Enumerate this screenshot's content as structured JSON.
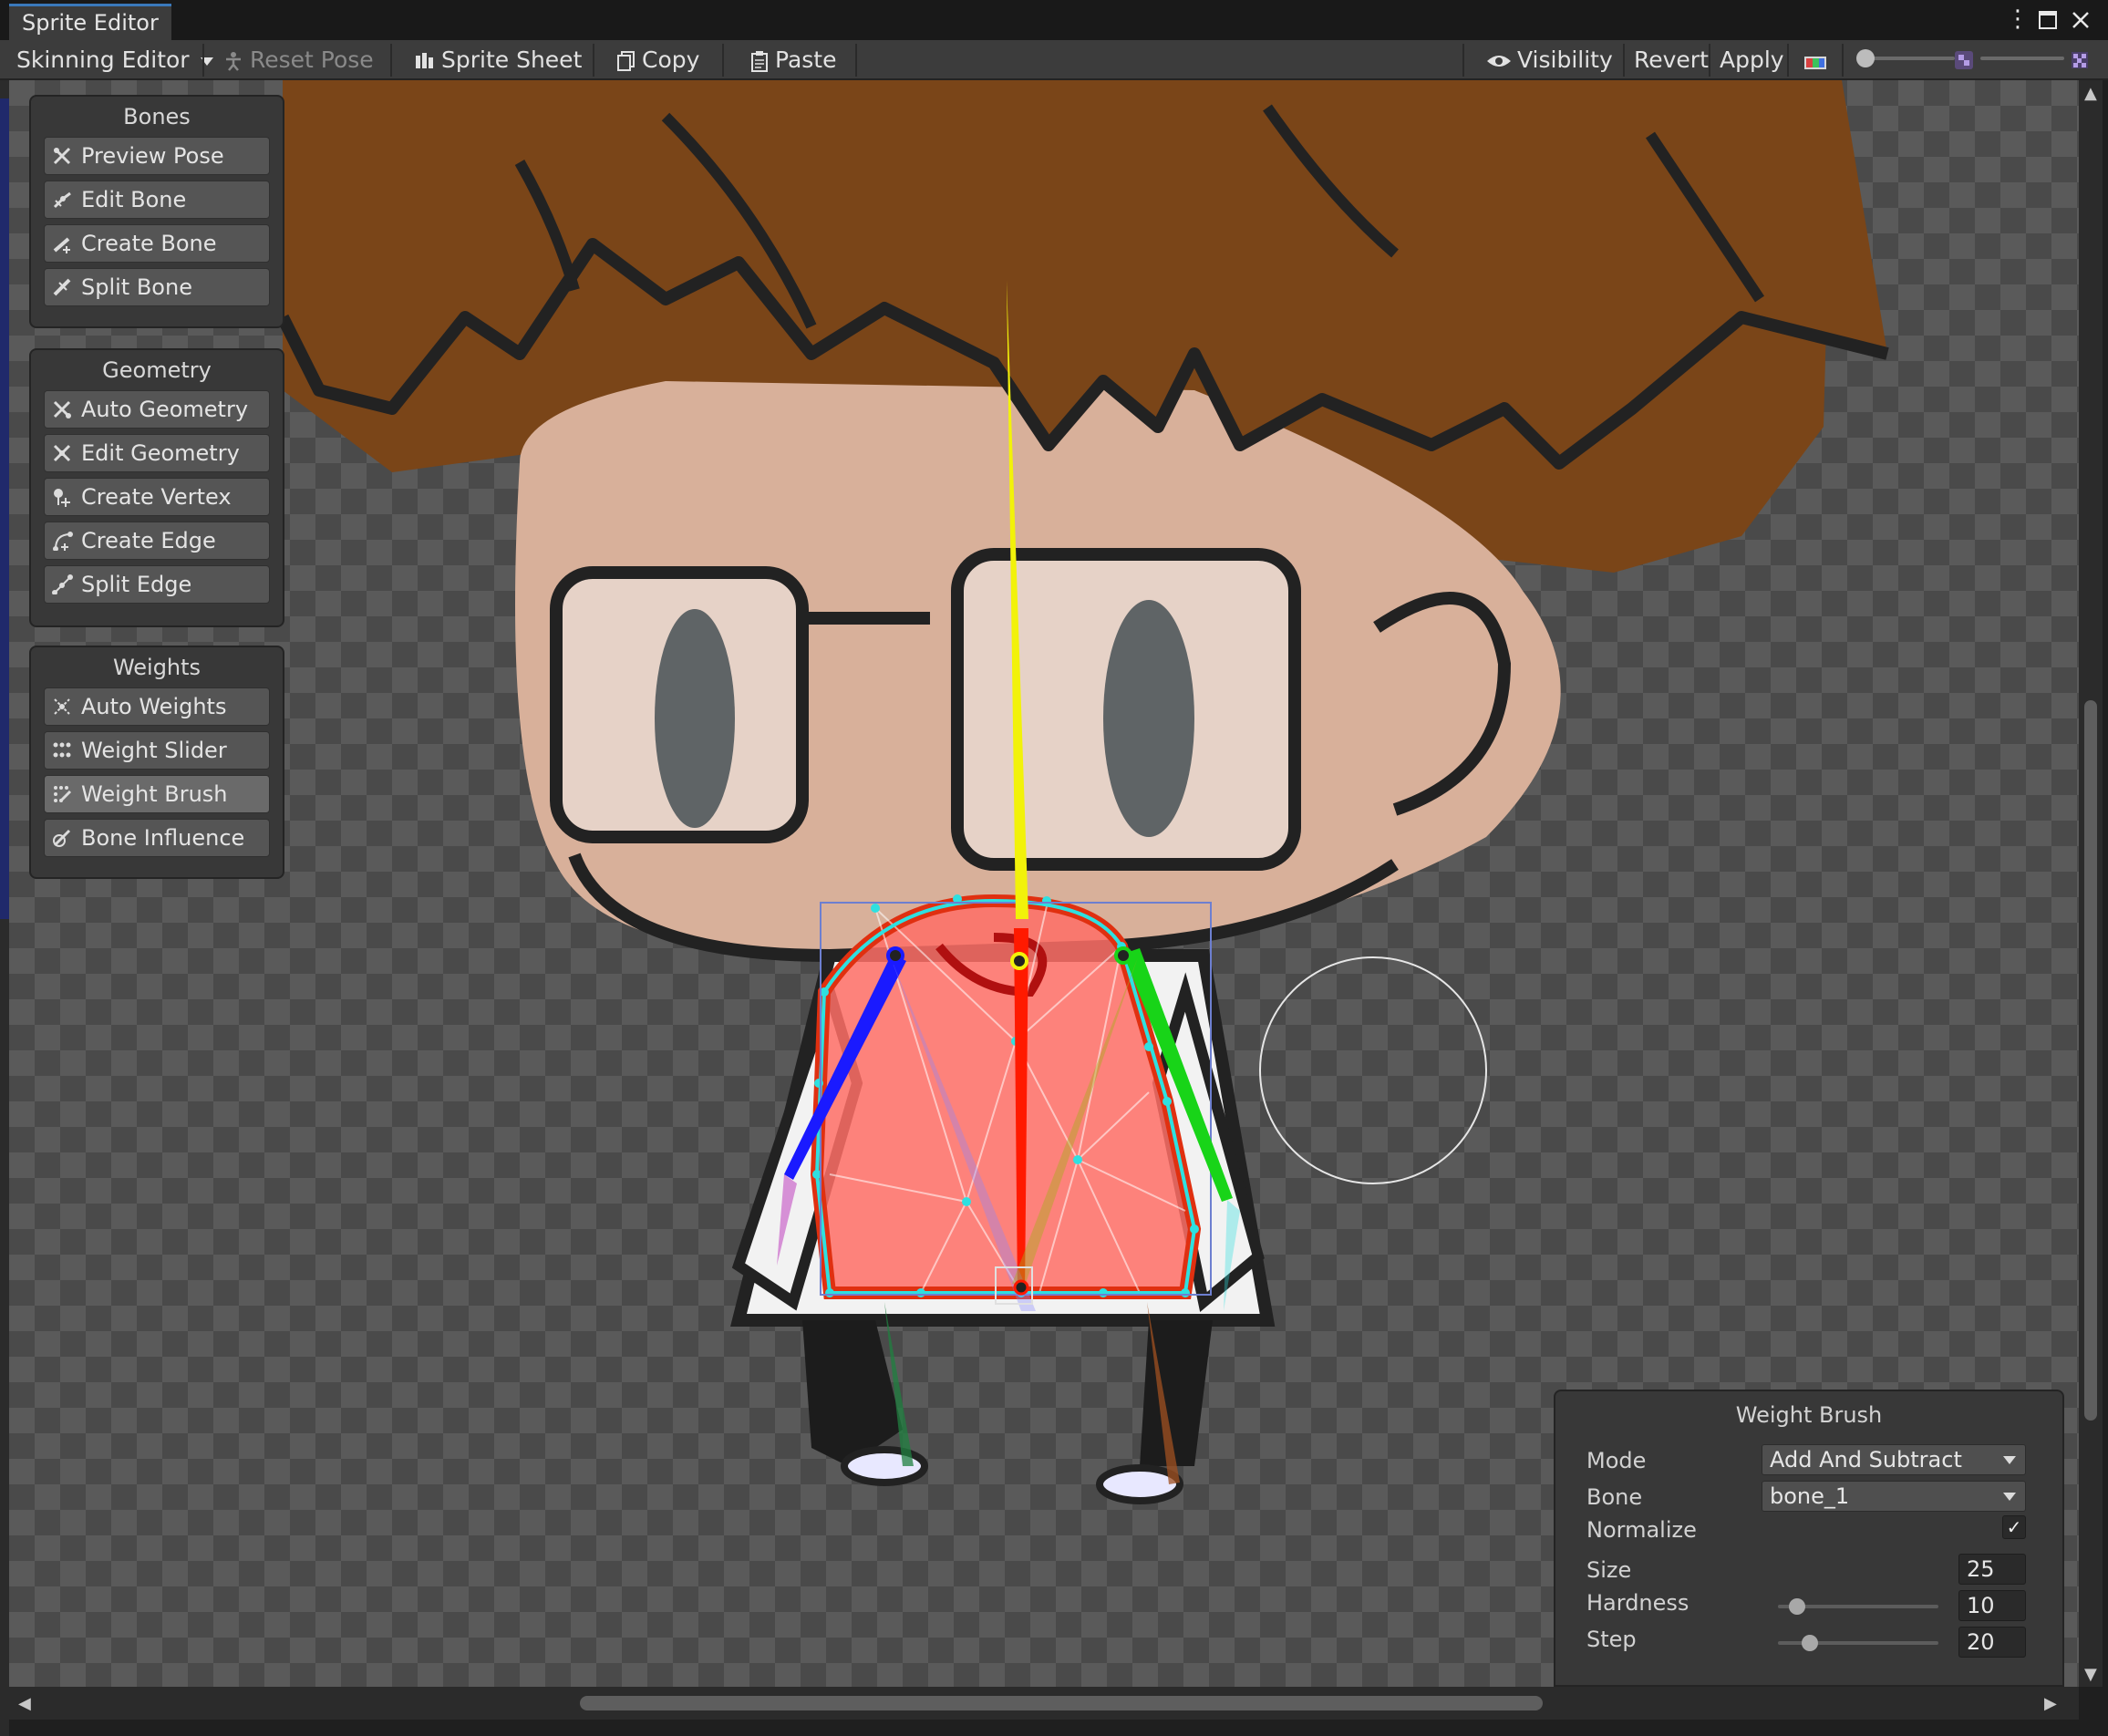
{
  "window": {
    "tab_title": "Sprite Editor",
    "menu_icon": "kebab-menu-icon",
    "maximize_icon": "maximize-icon",
    "close_icon": "close-icon"
  },
  "toolbar": {
    "mode_dropdown": "Skinning Editor",
    "reset_pose": "Reset Pose",
    "sprite_sheet": "Sprite Sheet",
    "copy": "Copy",
    "paste": "Paste",
    "visibility": "Visibility",
    "revert": "Revert",
    "apply": "Apply"
  },
  "panels": {
    "bones": {
      "title": "Bones",
      "items": [
        "Preview Pose",
        "Edit Bone",
        "Create Bone",
        "Split Bone"
      ]
    },
    "geometry": {
      "title": "Geometry",
      "items": [
        "Auto Geometry",
        "Edit Geometry",
        "Create Vertex",
        "Create Edge",
        "Split Edge"
      ]
    },
    "weights": {
      "title": "Weights",
      "items": [
        "Auto Weights",
        "Weight Slider",
        "Weight Brush",
        "Bone Influence"
      ],
      "active_item": "Weight Brush"
    }
  },
  "weight_brush": {
    "title": "Weight Brush",
    "mode_label": "Mode",
    "mode_value": "Add And Subtract",
    "bone_label": "Bone",
    "bone_value": "bone_1",
    "normalize_label": "Normalize",
    "normalize_checked": true,
    "size_label": "Size",
    "size_value": "25",
    "hardness_label": "Hardness",
    "hardness_value": "10",
    "step_label": "Step",
    "step_value": "20"
  },
  "colors": {
    "accent": "#3a79bb",
    "bone_yellow": "#f2f20a",
    "bone_red": "#ff1a00",
    "bone_blue": "#1a1aff",
    "bone_green": "#18d418",
    "mesh_outline": "#2ee0e0",
    "weight_fill": "#ff7a6e"
  }
}
